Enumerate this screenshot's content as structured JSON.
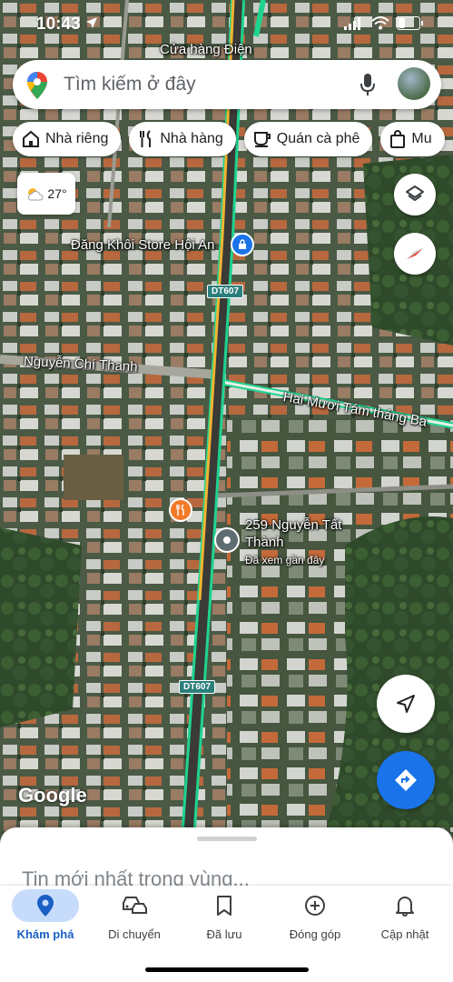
{
  "status_bar": {
    "time": "10:43"
  },
  "search": {
    "placeholder": "Tìm kiếm ở đây"
  },
  "chips": [
    {
      "label": "Nhà riêng",
      "icon": "home-icon"
    },
    {
      "label": "Nhà hàng",
      "icon": "restaurant-icon"
    },
    {
      "label": "Quán cà phê",
      "icon": "coffee-icon"
    },
    {
      "label": "Mu",
      "icon": "shopping-bag-icon"
    }
  ],
  "weather": {
    "temperature": "27°",
    "icon": "partly-cloudy-icon"
  },
  "map": {
    "labels": {
      "top_store": "Cửa hàng Điện",
      "store": "Đăng Khôi Store Hội An",
      "street_left": "Nguyễn Chí Thanh",
      "street_right": "Hai Mươi Tám tháng Ba",
      "pin_address": "259 Nguyễn Tất\nThành",
      "pin_sub": "Đã xem gần đây",
      "road_code_1": "DT607",
      "road_code_2": "DT607"
    },
    "brand": "Google",
    "colors": {
      "road": "#1fd38f",
      "center_line": "#f2b431",
      "accent": "#1a73e8"
    }
  },
  "sheet": {
    "title": "Tin mới nhất trong vùng..."
  },
  "nav": [
    {
      "label": "Khám phá",
      "icon": "explore-pin-icon",
      "active": true
    },
    {
      "label": "Di chuyển",
      "icon": "commute-icon",
      "active": false
    },
    {
      "label": "Đã lưu",
      "icon": "bookmark-icon",
      "active": false
    },
    {
      "label": "Đóng góp",
      "icon": "add-circle-icon",
      "active": false
    },
    {
      "label": "Cập nhật",
      "icon": "bell-icon",
      "active": false
    }
  ]
}
